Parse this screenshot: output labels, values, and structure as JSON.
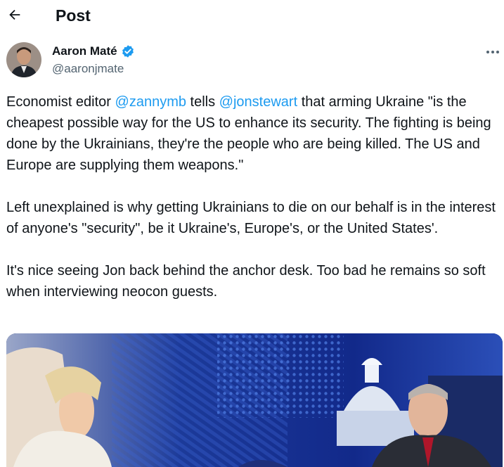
{
  "header": {
    "title": "Post"
  },
  "author": {
    "name": "Aaron Maté",
    "handle": "@aaronjmate",
    "verified": true
  },
  "tweet": {
    "p1": {
      "t1": "Economist editor ",
      "mention1": "@zannymb",
      "t2": " tells ",
      "mention2": "@jonstewart",
      "t3": " that arming Ukraine \"is the cheapest possible way for the US to enhance its security. The fighting is being done by the Ukrainians, they're the people who are being killed. The US and Europe are supplying them weapons.\""
    },
    "p2": "Left unexplained is why getting Ukrainians to die on our behalf is in the interest of anyone's \"security\", be it Ukraine's, Europe's, or the United States'.",
    "p3": "It's nice seeing Jon back behind the anchor desk. Too bad he remains so soft when interviewing neocon guests."
  },
  "icons": {
    "back": "arrow-left-icon",
    "verified": "verified-badge-icon",
    "more": "more-horizontal-icon"
  },
  "colors": {
    "link": "#1d9bf0",
    "secondary_text": "#536471",
    "text": "#0f1419"
  }
}
